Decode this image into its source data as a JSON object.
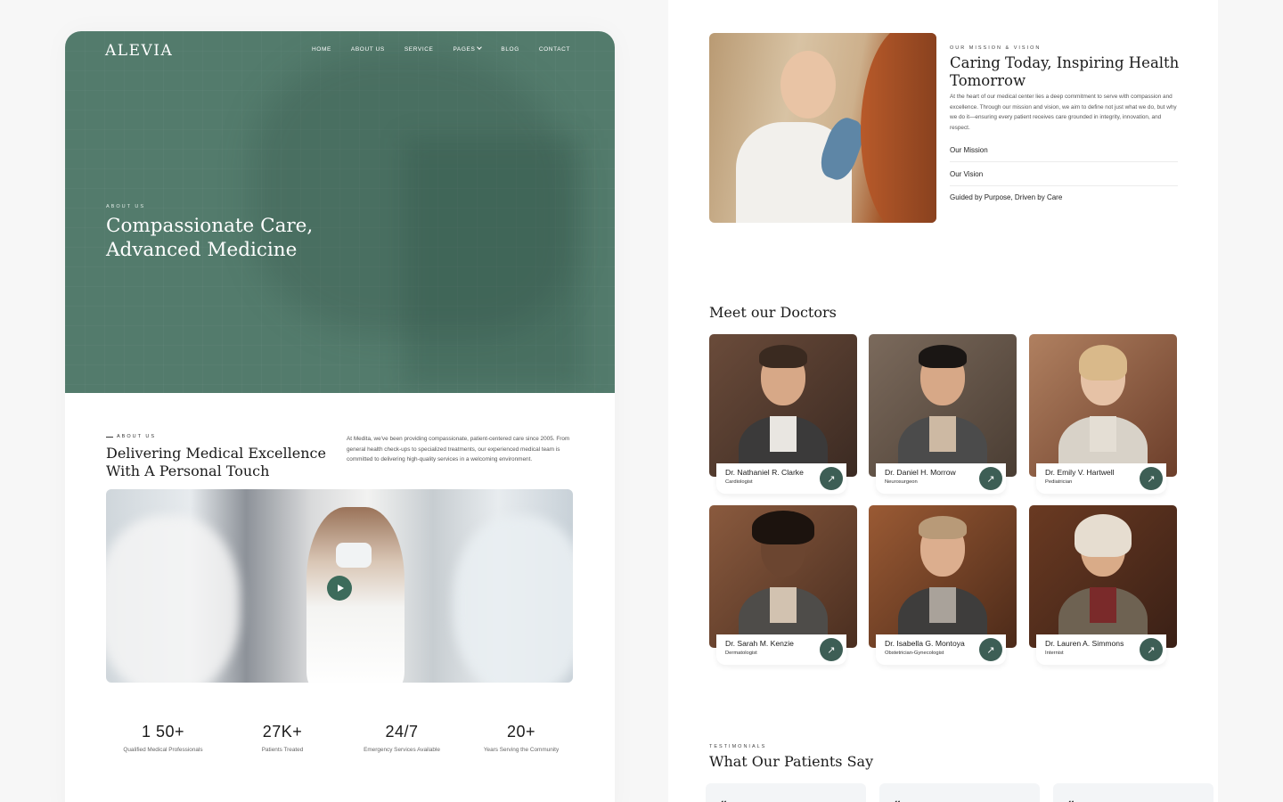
{
  "left_page": {
    "logo": "ALEVIA",
    "nav": [
      {
        "label": "HOME"
      },
      {
        "label": "ABOUT US"
      },
      {
        "label": "SERVICE"
      },
      {
        "label": "PAGES",
        "has_dropdown": true
      },
      {
        "label": "BLOG"
      },
      {
        "label": "CONTACT"
      }
    ],
    "hero": {
      "eyebrow": "ABOUT US",
      "title": "Compassionate Care, Advanced Medicine",
      "bg_color": "#537b6c"
    },
    "about": {
      "eyebrow": "ABOUT US",
      "title": "Delivering Medical Excellence With A Personal Touch",
      "description": "At Medita, we've been providing compassionate, patient-centered care since 2005. From general health check-ups to specialized treatments, our experienced medical team is committed to delivering high-quality services in a welcoming environment.",
      "video_icon": "play-icon"
    },
    "stats": [
      {
        "value": "1 50+",
        "label": "Qualified Medical Professionals"
      },
      {
        "value": "27K+",
        "label": "Patients Treated"
      },
      {
        "value": "24/7",
        "label": "Emergency Services Available"
      },
      {
        "value": "20+",
        "label": "Years Serving the Community"
      }
    ]
  },
  "right_page": {
    "mission": {
      "eyebrow": "OUR MISSION & VISION",
      "title": "Caring Today, Inspiring Health Tomorrow",
      "description": "At the heart of our medical center lies a deep commitment to serve with compassion and excellence. Through our mission and vision, we aim to define not just what we do, but why we do it—ensuring every patient receives care grounded in integrity, innovation, and respect.",
      "items": [
        "Our Mission",
        "Our Vision",
        "Guided by Purpose, Driven by Care"
      ]
    },
    "doctors": {
      "title": "Meet our Doctors",
      "list": [
        {
          "name": "Dr. Nathaniel R. Clarke",
          "role": "Cardiologist"
        },
        {
          "name": "Dr. Daniel H. Morrow",
          "role": "Neurosurgeon"
        },
        {
          "name": "Dr. Emily V. Hartwell",
          "role": "Pediatrician"
        },
        {
          "name": "Dr. Sarah M. Kenzie",
          "role": "Dermatologist"
        },
        {
          "name": "Dr. Isabella G. Montoya",
          "role": "Obstetrician-Gynecologist"
        },
        {
          "name": "Dr. Lauren A. Simmons",
          "role": "Internist"
        }
      ],
      "button_icon": "arrow-up-right-icon",
      "accent": "#3d5e55"
    },
    "testimonials": {
      "eyebrow": "TESTIMONIALS",
      "title": "What Our Patients Say",
      "quote_glyph": "❝"
    }
  }
}
